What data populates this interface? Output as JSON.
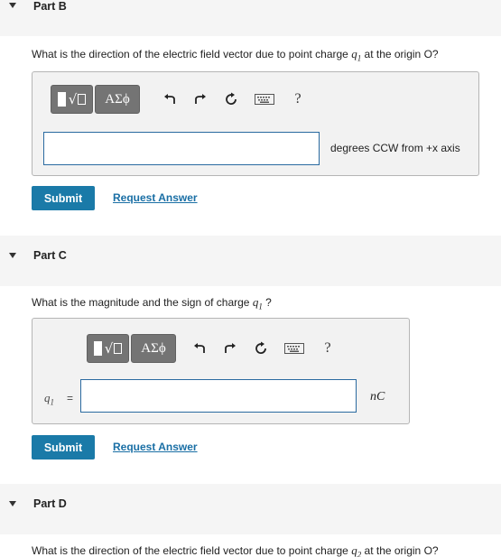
{
  "partB": {
    "title": "Part B",
    "question_prefix": "What is the direction of the electric field vector due to point charge ",
    "question_var": "q",
    "question_sub": "1",
    "question_suffix": " at the origin O?",
    "toolbar": {
      "greek_label": "ΑΣϕ",
      "help_label": "?"
    },
    "answer_value": "",
    "unit": "degrees CCW from +x axis",
    "submit_label": "Submit",
    "request_label": "Request Answer"
  },
  "partC": {
    "title": "Part C",
    "question_prefix": "What is the magnitude and the sign of charge ",
    "question_var": "q",
    "question_sub": "1",
    "question_suffix": " ?",
    "toolbar": {
      "greek_label": "ΑΣϕ",
      "help_label": "?"
    },
    "var_label": "q",
    "var_sub": "1",
    "eq_label": "=",
    "answer_value": "",
    "unit": "nC",
    "submit_label": "Submit",
    "request_label": "Request Answer"
  },
  "partD": {
    "title": "Part D",
    "question_prefix": "What is the direction of the electric field vector due to point charge ",
    "question_var": "q",
    "question_sub": "2",
    "question_suffix": " at the origin O?"
  }
}
